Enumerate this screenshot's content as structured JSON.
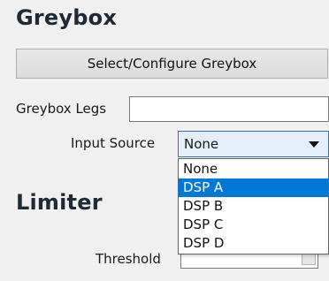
{
  "greybox": {
    "title": "Greybox",
    "configure_button": "Select/Configure Greybox",
    "legs_label": "Greybox Legs",
    "legs_value": "",
    "input_source_label": "Input Source",
    "input_source_value": "None",
    "input_source_options": [
      "None",
      "DSP A",
      "DSP B",
      "DSP C",
      "DSP D"
    ],
    "highlighted_option": "DSP A"
  },
  "limiter": {
    "title": "Limiter",
    "threshold_label": "Threshold"
  },
  "colors": {
    "highlight": "#0078d7",
    "combo_background": "#e4eef9",
    "window_background": "#f0f0f0"
  },
  "icons": {
    "combo_arrow": "triangle-down-icon"
  }
}
